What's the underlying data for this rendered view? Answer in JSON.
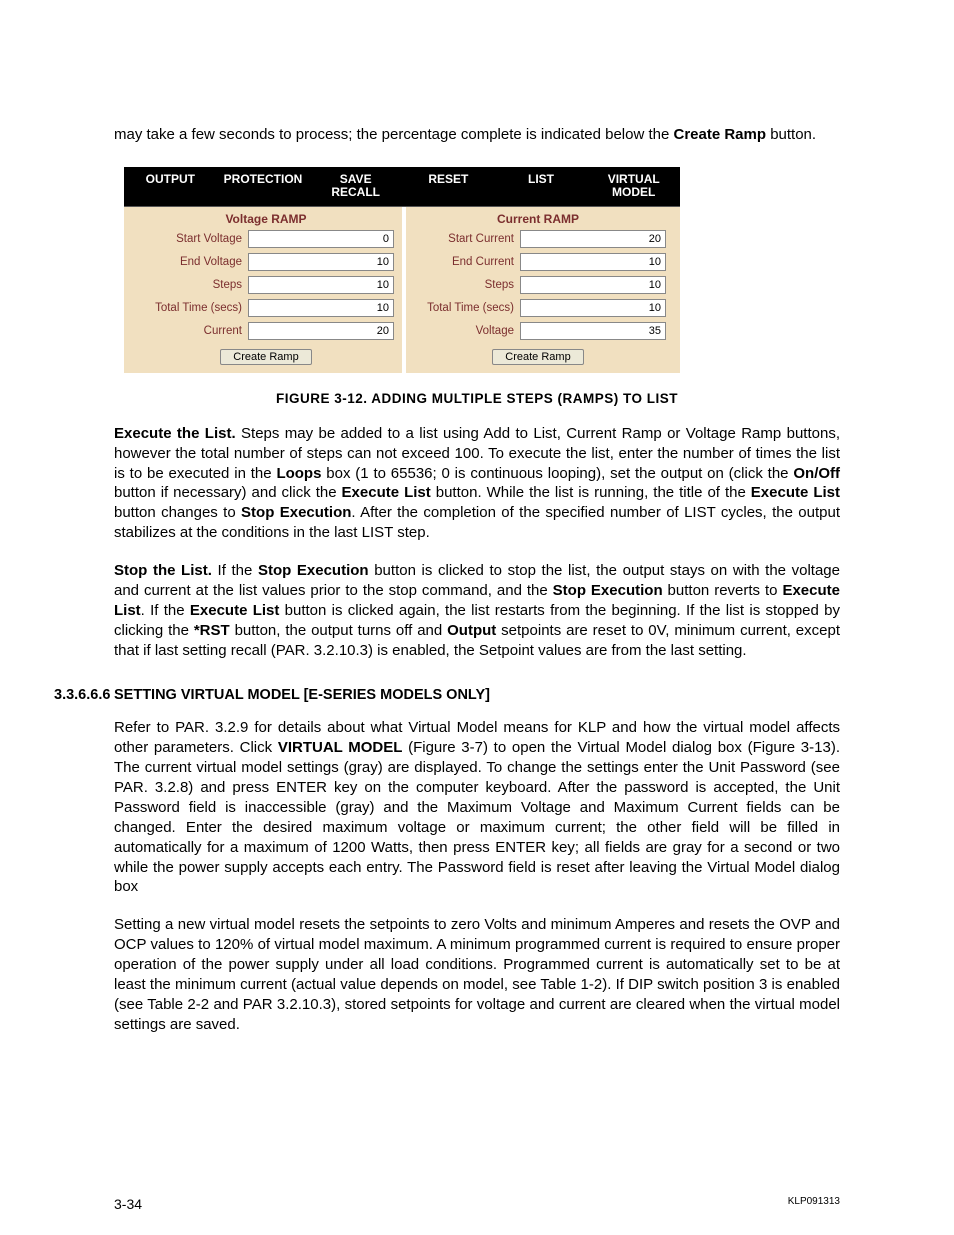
{
  "intro": {
    "t1": "may take a few seconds to process; the percentage complete is indicated below the ",
    "b1": "Create Ramp",
    "t2": " button."
  },
  "tabs": {
    "output": "OUTPUT",
    "protection": "PROTECTION",
    "save_recall": "SAVE\nRECALL",
    "reset": "RESET",
    "list": "LIST",
    "virtual_model": "VIRTUAL\nMODEL"
  },
  "left": {
    "title": "Voltage RAMP",
    "rows": [
      {
        "label": "Start Voltage",
        "value": "0"
      },
      {
        "label": "End Voltage",
        "value": "10"
      },
      {
        "label": "Steps",
        "value": "10"
      },
      {
        "label": "Total Time (secs)",
        "value": "10"
      },
      {
        "label": "Current",
        "value": "20"
      }
    ],
    "button": "Create Ramp"
  },
  "right": {
    "title": "Current RAMP",
    "rows": [
      {
        "label": "Start Current",
        "value": "20"
      },
      {
        "label": "End Current",
        "value": "10"
      },
      {
        "label": "Steps",
        "value": "10"
      },
      {
        "label": "Total Time (secs)",
        "value": "10"
      },
      {
        "label": "Voltage",
        "value": "35"
      }
    ],
    "button": "Create Ramp"
  },
  "figure_caption": "FIGURE 3-12.    ADDING MULTIPLE STEPS (RAMPS) TO LIST",
  "exec": {
    "b1": "Execute the List.",
    "t1": " Steps may be added to a list using Add to List, Current Ramp or Voltage Ramp buttons, however the total number of steps can not exceed 100. To execute the list, enter the number of times the list is to be executed in the ",
    "b2": "Loops",
    "t2": " box (1 to 65536; 0 is continuous looping), set the output on (click the ",
    "b3": "On/Off",
    "t3": " button if necessary) and click the ",
    "b4": "Execute List",
    "t4": " button. While the list is running, the title of the ",
    "b5": "Execute List",
    "t5": " button changes to ",
    "b6": "Stop Execution",
    "t6": ". After the completion of the specified number of LIST cycles, the output stabilizes at the conditions in the last LIST step."
  },
  "stop": {
    "b1": "Stop the List.",
    "t1": " If the ",
    "b2": "Stop Execution",
    "t2": " button is clicked to stop the list, the output stays on with the voltage and current at the list values prior to the stop command, and the ",
    "b3": "Stop Execution",
    "t3": " button reverts to ",
    "b4": "Execute List",
    "t4": ". If the ",
    "b5": "Execute List",
    "t5": " button is clicked again, the list restarts from the beginning. If the list is stopped by clicking the ",
    "b6": "*RST",
    "t6": " button, the output turns off and ",
    "b7": "Output",
    "t7": " setpoints are reset to 0V, minimum current, except that if last setting recall (PAR. 3.2.10.3) is enabled, the Setpoint values are from the last setting."
  },
  "section": {
    "num": "3.3.6.6.6",
    "title": "SETTING VIRTUAL MODEL [E-SERIES MODELS ONLY]"
  },
  "vm1": {
    "t1": "Refer to PAR. 3.2.9 for details about what Virtual Model means for KLP and how the virtual model affects other parameters. Click ",
    "b1": "VIRTUAL MODEL",
    "t2": " (Figure 3-7) to open the Virtual Model dialog box (Figure 3-13). The current virtual model settings (gray) are displayed. To change the settings enter the Unit Password (see PAR. 3.2.8) and press ENTER key on the computer keyboard. After the password is accepted, the Unit Password field is inaccessible (gray) and the Maximum Voltage and Maximum Current fields can be changed. Enter the desired maximum voltage or maximum current; the other field will be filled in automatically for a maximum of 1200 Watts, then press ENTER key; all fields are gray for a second or two while the power supply accepts each entry. The Password field is reset after leaving the Virtual Model dialog box"
  },
  "vm2": "Setting a new virtual model resets the setpoints to zero Volts and minimum Amperes and resets the OVP and OCP values to 120% of virtual model maximum. A minimum programmed current is required to ensure proper operation of the power supply under all load conditions. Programmed current is automatically set to be at least the minimum current (actual value depends on model, see Table 1-2). If DIP switch position 3 is enabled (see Table 2-2 and PAR 3.2.10.3), stored setpoints for voltage and current are cleared when the virtual model settings are saved.",
  "footer": {
    "left": "3-34",
    "right": "KLP091313"
  }
}
